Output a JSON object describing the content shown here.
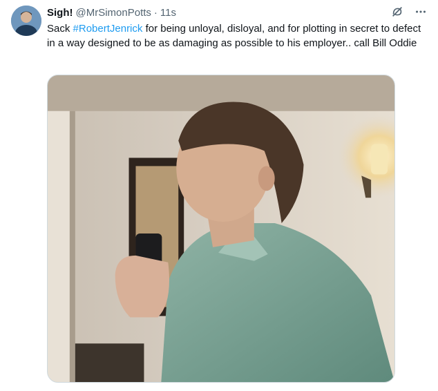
{
  "author": {
    "display_name": "Sigh!",
    "handle": "@MrSimonPotts",
    "separator": "·",
    "time": "11s"
  },
  "tweet": {
    "text_before": "Sack ",
    "hashtag": "#RobertJenrick",
    "text_after": " for being unloyal, disloyal, and for plotting in secret to defect in a way designed to be as damaging as possible to his employer.. call Bill Oddie"
  },
  "icons": {
    "grok": "grok-icon",
    "more": "more-icon"
  },
  "colors": {
    "text": "#0f1419",
    "secondary": "#536471",
    "link": "#1d9bf0"
  }
}
